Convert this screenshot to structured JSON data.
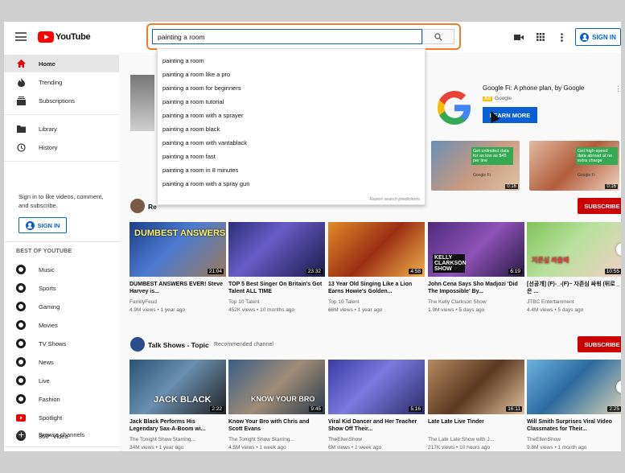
{
  "header": {
    "logo_text": "YouTube",
    "search_value": "painting a room",
    "signin_label": "SIGN IN"
  },
  "search_suggestions": {
    "items": [
      "painting a room",
      "painting a room like a pro",
      "painting a room for beginners",
      "painting a room tutorial",
      "painting a room with a sprayer",
      "painting a room black",
      "painting a room with vantablack",
      "painting a room fast",
      "painting a room in 8 minutes",
      "painting a room with a spray gun"
    ],
    "report_text": "Report search predictions"
  },
  "sidebar": {
    "items": [
      {
        "label": "Home",
        "icon": "home-icon"
      },
      {
        "label": "Trending",
        "icon": "flame-icon"
      },
      {
        "label": "Subscriptions",
        "icon": "subscriptions-icon"
      },
      {
        "label": "Library",
        "icon": "folder-icon"
      },
      {
        "label": "History",
        "icon": "history-icon"
      }
    ],
    "signin_text": "Sign in to like videos, comment, and subscribe.",
    "signin_label": "SIGN IN",
    "best_of_heading": "BEST OF YOUTUBE",
    "best_of": [
      "Music",
      "Sports",
      "Gaming",
      "Movies",
      "TV Shows",
      "News",
      "Live",
      "Fashion",
      "Spotlight",
      "360° Video"
    ],
    "browse_label": "Browse channels"
  },
  "ad": {
    "title": "Google Fi: A phone plan, by Google",
    "badge": "Ad",
    "advertiser": "Google",
    "button_label": "LEARN MORE",
    "thumb1_text": "Get unlimited data for as low as $45 per line",
    "thumb1_duration": "0:16",
    "thumb2_text": "Get high-speed data abroad at no extra charge",
    "thumb2_duration": "0:16",
    "thumb_brand": "Google Fi"
  },
  "shelf1": {
    "title_fragment": "Re",
    "subscribe_label": "SUBSCRIBE",
    "videos": [
      {
        "title": "DUMBEST ANSWERS EVER! Steve Harvey is...",
        "channel": "FamilyFeud",
        "meta": "4.9M views • 1 year ago",
        "duration": "21:04",
        "caption": "DUMBEST ANSWERS"
      },
      {
        "title": "TOP 5 Best Singer On Britain's Got Talent ALL TIME",
        "channel": "Top 10 Talent",
        "meta": "452K views • 10 months ago",
        "duration": "23:32",
        "caption": ""
      },
      {
        "title": "13 Year Old Singing Like a Lion Earns Howie's Golden...",
        "channel": "Top 10 Talent",
        "meta": "66M views • 1 year ago",
        "duration": "4:58",
        "caption": ""
      },
      {
        "title": "John Cena Says Sho Madjozi 'Did The Impossible' By...",
        "channel": "The Kelly Clarkson Show",
        "meta": "1.9M views • 5 days ago",
        "duration": "6:19",
        "caption": "KELLY CLARKSON SHOW"
      },
      {
        "title": "[선공개] (F)-_-(F)~ 자존심 싸워 (뒤로 _ 은 ...",
        "channel": "JTBC Entertainment",
        "meta": "4.4M views • 5 days ago",
        "duration": "10:55",
        "caption": "지존심 싸움에"
      }
    ]
  },
  "shelf2": {
    "title": "Talk Shows - Topic",
    "subtitle": "Recommended channel",
    "subscribe_label": "SUBSCRIBE",
    "videos": [
      {
        "title": "Jack Black Performs His Legendary Sax-A-Boom wi...",
        "channel": "The Tonight Show Starring...",
        "meta": "34M views • 1 year ago",
        "duration": "2:22",
        "caption": "JACK BLACK"
      },
      {
        "title": "Know Your Bro with Chris and Scott Evans",
        "channel": "The Tonight Show Starring...",
        "meta": "4.5M views • 1 week ago",
        "duration": "9:45",
        "caption": "KNOW YOUR BRO"
      },
      {
        "title": "Viral Kid Dancer and Her Teacher Show Off Their...",
        "channel": "TheEllenShow",
        "meta": "6M views • 1 week ago",
        "duration": "5:16",
        "caption": ""
      },
      {
        "title": "Late Late Live Tinder",
        "channel": "The Late Late Show with J...",
        "meta": "217K views • 10 hours ago",
        "duration": "16:11",
        "caption": ""
      },
      {
        "title": "Will Smith Surprises Viral Video Classmates for Their...",
        "channel": "TheEllenShow",
        "meta": "9.8M views • 1 month ago",
        "duration": "2:25",
        "caption": ""
      }
    ]
  }
}
